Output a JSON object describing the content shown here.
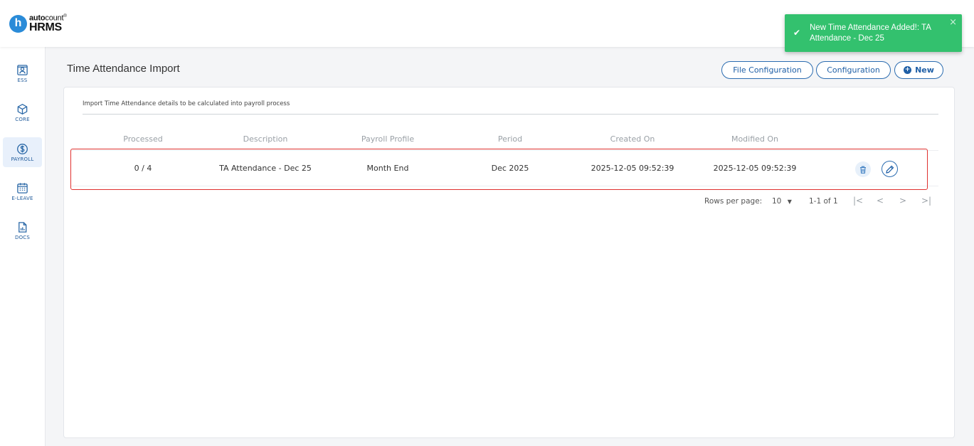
{
  "app": {
    "logo_letter": "h",
    "logo_brand_bold": "auto",
    "logo_brand_rest": "count",
    "logo_registered": "®",
    "logo_product": "HRMS"
  },
  "sidebar": {
    "items": [
      {
        "label": "ESS",
        "icon": "ess-icon"
      },
      {
        "label": "CORE",
        "icon": "core-icon"
      },
      {
        "label": "PAYROLL",
        "icon": "payroll-icon",
        "active": true
      },
      {
        "label": "E-LEAVE",
        "icon": "calendar-icon"
      },
      {
        "label": "DOCS",
        "icon": "docs-icon"
      }
    ]
  },
  "page": {
    "title": "Time Attendance Import",
    "description": "Import Time Attendance details to be calculated into payroll process"
  },
  "toolbar": {
    "file_configuration_label": "File Configuration",
    "configuration_label": "Configuration",
    "new_label": "New"
  },
  "table": {
    "columns": [
      "Processed",
      "Description",
      "Payroll Profile",
      "Period",
      "Created On",
      "Modified On"
    ],
    "rows": [
      {
        "processed": "0 / 4",
        "description": "TA Attendance - Dec 25",
        "payroll_profile": "Month End",
        "period": "Dec 2025",
        "created_on": "2025-12-05 09:52:39",
        "modified_on": "2025-12-05 09:52:39"
      }
    ]
  },
  "pagination": {
    "rows_per_page_label": "Rows per page:",
    "rows_per_page_value": "10",
    "range": "1-1 of 1"
  },
  "toast": {
    "message": "New Time Attendance Added!: TA Attendance - Dec 25",
    "close_symbol": "×"
  },
  "colors": {
    "accent": "#2b6cb0",
    "toast_success": "#33c16e",
    "highlight": "#e0312f"
  }
}
